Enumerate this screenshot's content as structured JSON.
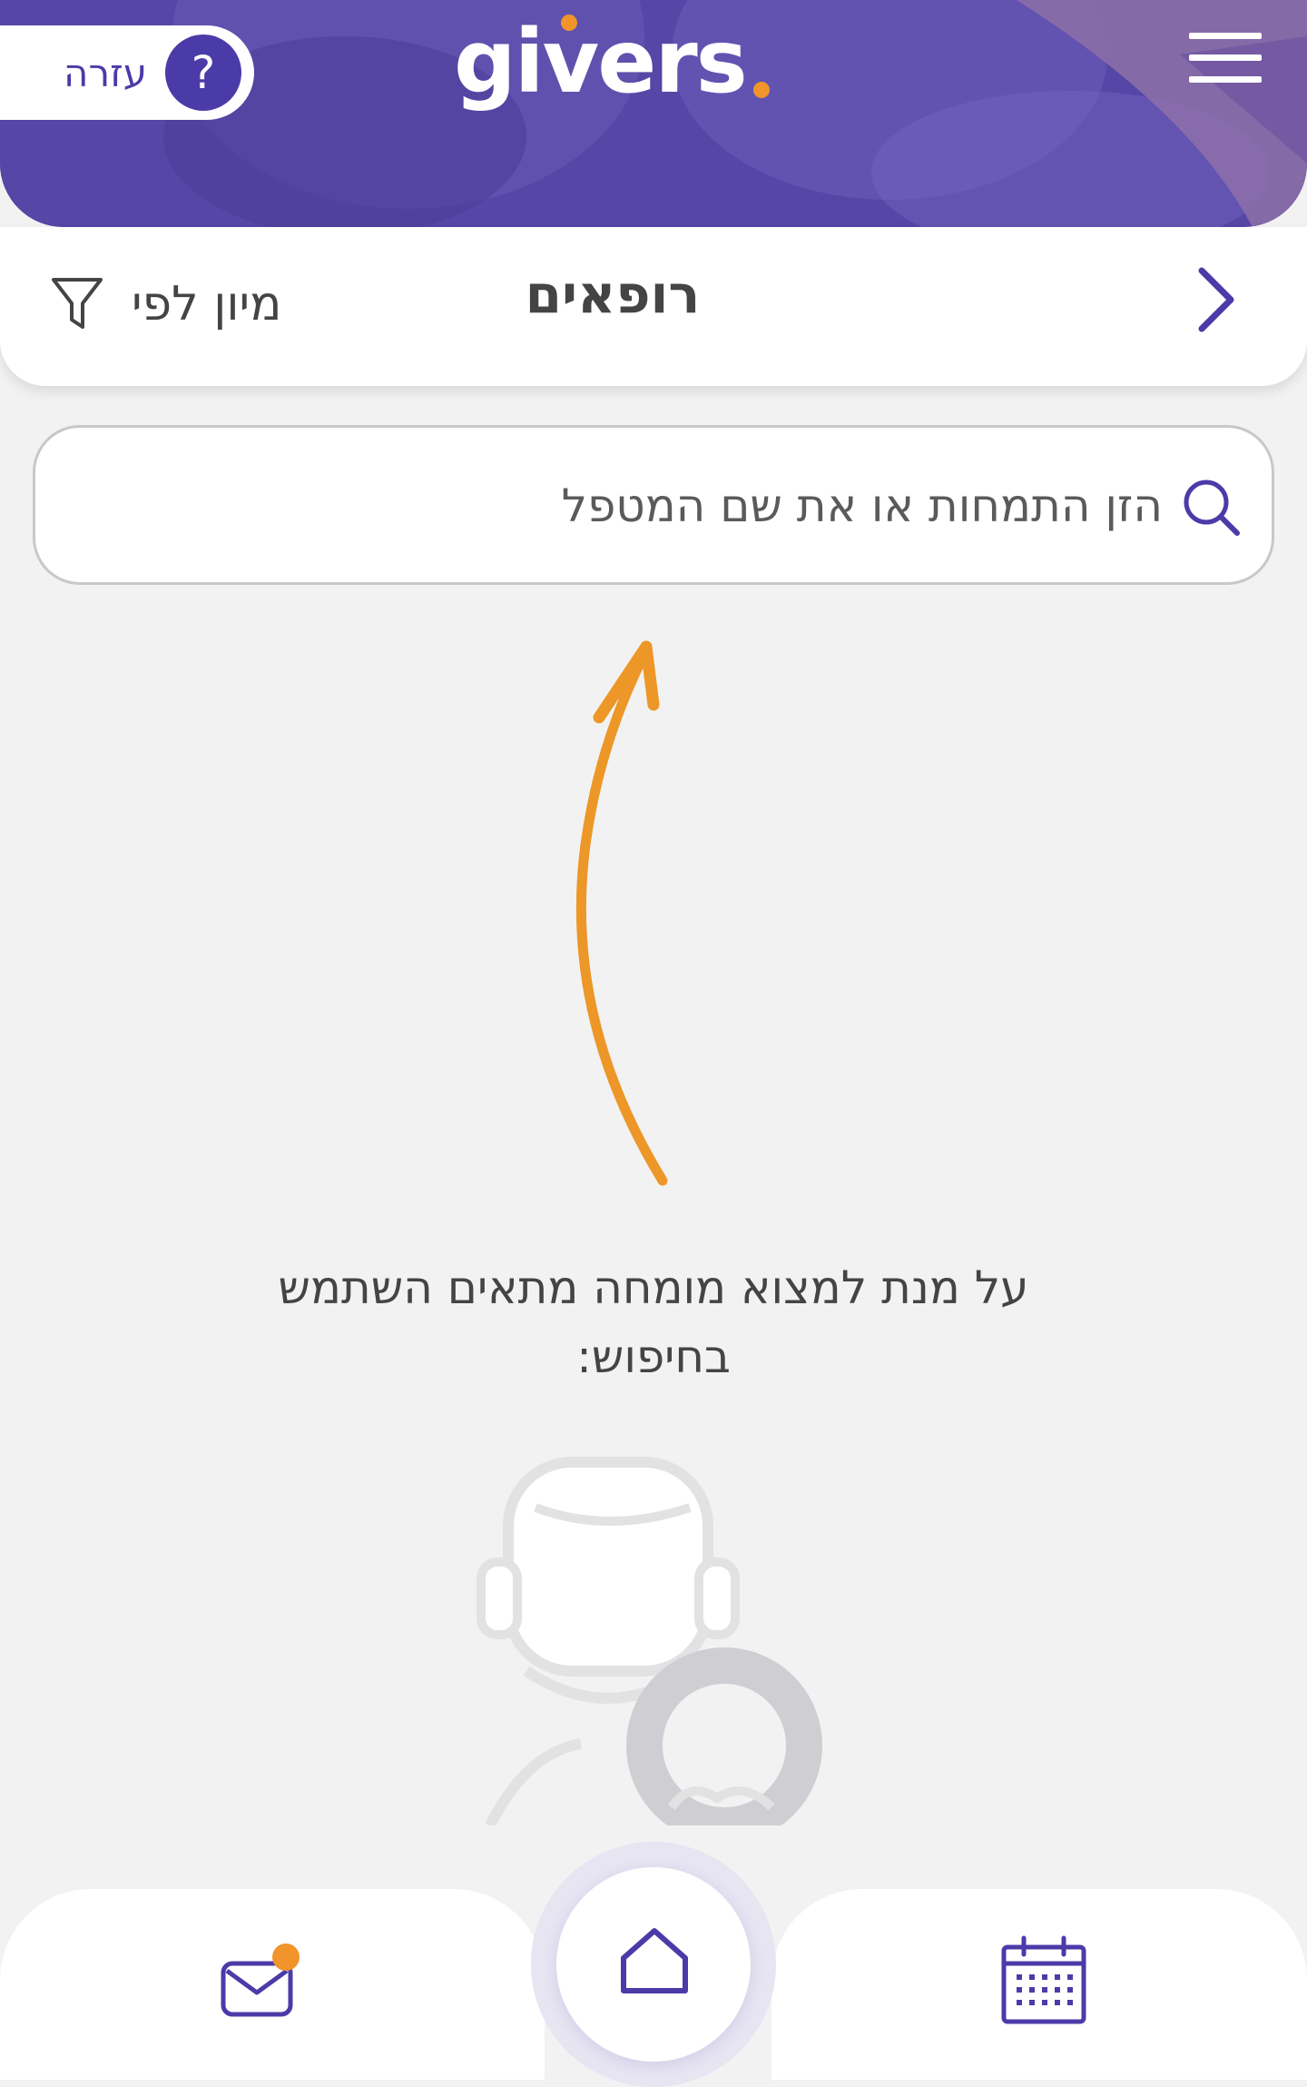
{
  "header": {
    "help_label": "עזרה",
    "help_symbol": "?",
    "logo_text": "givers",
    "menu_icon": "hamburger-icon"
  },
  "titlebar": {
    "title": "רופאים",
    "sort_label": "מיון לפי",
    "back_icon": "chevron-right-icon",
    "filter_icon": "filter-icon"
  },
  "search": {
    "placeholder": "הזן התמחות או את שם המטפל",
    "value": "",
    "icon": "search-icon"
  },
  "hint": {
    "line1": "על מנת למצוא מומחה מתאים השתמש",
    "line2": "בחיפוש:"
  },
  "bottom_nav": {
    "items": [
      {
        "name": "messages",
        "icon": "mail-icon",
        "has_badge": true
      },
      {
        "name": "home",
        "icon": "home-icon",
        "active": true
      },
      {
        "name": "calendar",
        "icon": "calendar-icon"
      }
    ]
  },
  "colors": {
    "brand_purple": "#4b3ba8",
    "header_overlay": "#5a4aa8",
    "accent_orange": "#f0942b",
    "background": "#f2f2f2",
    "text_dark": "#444444"
  }
}
